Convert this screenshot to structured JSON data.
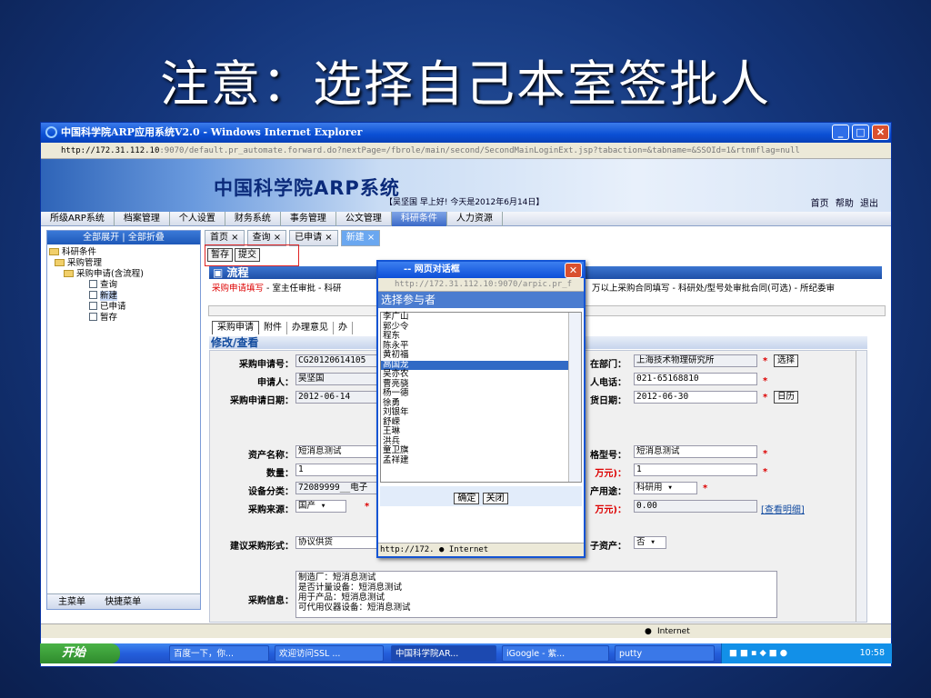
{
  "slide_title": "注意：选择自己本室签批人",
  "window": {
    "title": "中国科学院ARP应用系统V2.0 - Windows Internet Explorer",
    "min": "_",
    "max": "□",
    "close": "✕",
    "address_host": "http://172.31.112.10",
    "address_rest": ":9070/default.pr_automate.forward.do?nextPage=/fbrole/main/second/SecondMainLoginExt.jsp?tabaction=&tabname=&SSOId=1&rtnmflag=null"
  },
  "banner": {
    "system_name": "中国科学院ARP系统",
    "user_line": "【吴坚国 早上好! 今天是2012年6月14日】",
    "links": "首页  帮助  退出"
  },
  "menu": [
    "所级ARP系统",
    "档案管理",
    "个人设置",
    "财务系统",
    "事务管理",
    "公文管理",
    "科研条件",
    "人力资源"
  ],
  "left": {
    "header": "全部展开 | 全部折叠",
    "tree": [
      "科研条件",
      "采购管理",
      "采购申请(含流程)",
      "查询",
      "新建",
      "已申请",
      "暂存"
    ],
    "bottom": [
      "主菜单",
      "快捷菜单"
    ]
  },
  "tabs": [
    "首页 ×",
    "查询 ×",
    "已申请 ×",
    "新建 ×"
  ],
  "buttons": {
    "save": "暂存",
    "submit": "提交"
  },
  "flow": {
    "header": "流程",
    "current": "采购申请填写",
    "rest": " - 室主任审批 - 科研",
    "rest2": "万以上采购合同填写 - 科研处/型号处审批合同(可选) - 所纪委审"
  },
  "subtabs": [
    "采购申请",
    "附件",
    "办理意见",
    "办"
  ],
  "edit_title": "修改/查看",
  "form": {
    "apply_no_label": "采购申请号：",
    "apply_no": "CG20120614105",
    "applicant_label": "申请人：",
    "applicant": "吴坚国",
    "apply_date_label": "采购申请日期：",
    "apply_date": "2012-06-14",
    "dept_label": "在部门：",
    "dept": "上海技术物理研究所",
    "select_btn": "选择",
    "phone_label": "人电话：",
    "phone": "021-65168810",
    "delivery_label": "货日期：",
    "delivery": "2012-06-30",
    "calendar_btn": "日历",
    "asset_label": "资产名称：",
    "asset": "短消息测试",
    "spec_label": "格型号：",
    "spec": "短消息测试",
    "qty_label": "数量：",
    "qty": "1",
    "amount_label": "万元)：",
    "amount": "1",
    "category_label": "设备分类：",
    "category": "72089999__电子",
    "usage_label": "产用途：",
    "usage": "科研用",
    "source_label": "采购来源：",
    "source": "国产",
    "total_label": "万元)：",
    "total": "0.00",
    "detail_link": "[查看明细]",
    "method_label": "建议采购形式：",
    "method": "协议供货",
    "easset_label": "子资产：",
    "easset": "否",
    "info_label": "采购信息：",
    "info": [
      "制造厂：短消息测试",
      "是否计量设备：短消息测试",
      "用于产品：短消息测试",
      "可代用仪器设备：短消息测试"
    ]
  },
  "dialog": {
    "title": "-- 网页对话框",
    "address": "http://172.31.112.10:9070/arpic.pr_f",
    "heading": "选择参与者",
    "people": [
      "李广山",
      "郭少令",
      "程东",
      "陈永平",
      "黄初福",
      "高国龙",
      "吴亦农",
      "曹亮骁",
      "杨一德",
      "徐勇",
      "刘银年",
      "舒嵘",
      "王琳",
      "洪兵",
      "童卫旗",
      "孟祥建"
    ],
    "selected": "高国龙",
    "ok": "确定",
    "close": "关闭",
    "status": "http://172.",
    "zone": "Internet"
  },
  "status": {
    "zone": "Internet"
  },
  "taskbar": {
    "start": "开始",
    "tasks": [
      "百度一下，你...",
      "欢迎访问SSL ...",
      "中国科学院AR...",
      "iGoogle - 紫...",
      "putty"
    ],
    "clock": "10:58"
  }
}
